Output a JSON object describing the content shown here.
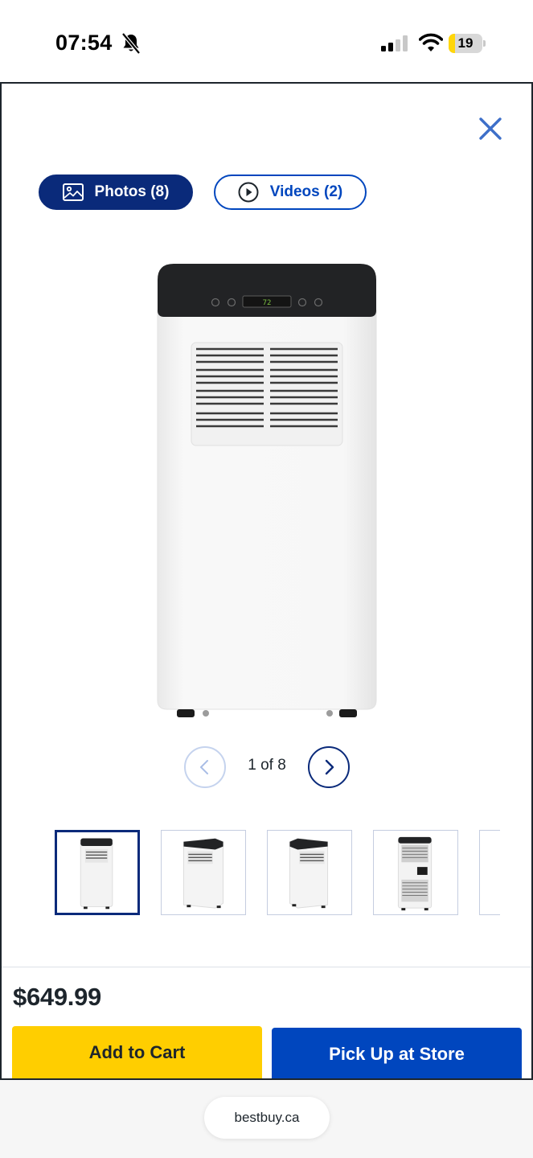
{
  "status_bar": {
    "time": "07:54",
    "battery_level": "19",
    "battery_fraction": 0.19,
    "icons": [
      "bell-slash-icon",
      "cellular-signal-icon",
      "wifi-icon",
      "battery-icon"
    ]
  },
  "modal": {
    "close_icon": "close-icon",
    "tabs": {
      "photos_label": "Photos (8)",
      "photos_icon": "image-icon",
      "videos_label": "Videos (2)",
      "videos_icon": "play-circle-icon"
    },
    "pager": {
      "text": "1 of 8",
      "prev_icon": "chevron-left-icon",
      "next_icon": "chevron-right-icon"
    },
    "thumbnails": {
      "visible_count": 5,
      "active_index": 0
    },
    "price": "$649.99",
    "add_to_cart_label": "Add to Cart",
    "pickup_label": "Pick Up at Store"
  },
  "browser": {
    "url": "bestbuy.ca"
  },
  "colors": {
    "primary_blue": "#0046be",
    "navy": "#0a2a7a",
    "cart_yellow": "#ffce00",
    "battery_yellow": "#ffd60a"
  }
}
